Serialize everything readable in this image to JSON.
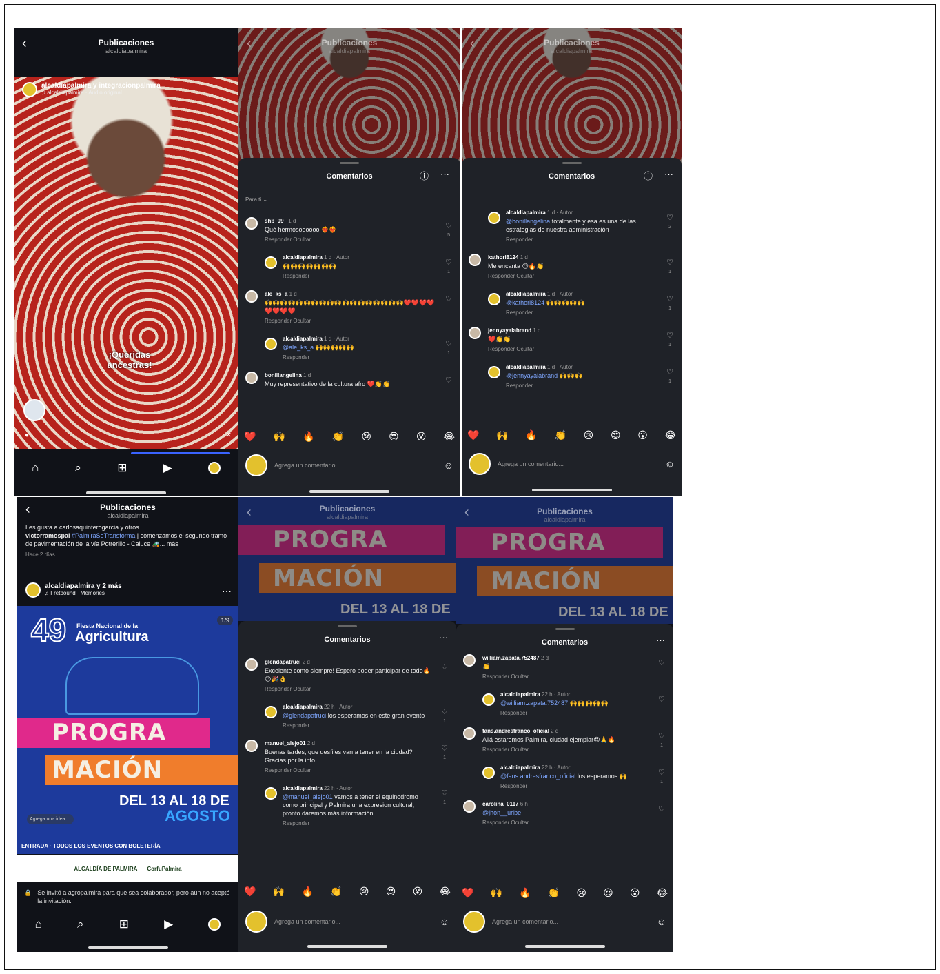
{
  "header": {
    "title": "Publicaciones",
    "subtitle": "alcaldiapalmira"
  },
  "reel": {
    "users": "alcaldiapalmira y integracionpalmira",
    "audio": "♫ alcaldiapalmira · Audio original",
    "overlay_text": "¡Queridas ancestras!"
  },
  "nav": {
    "home": "⌂",
    "search": "⌕",
    "create": "⊞",
    "reels": "▶",
    "profile": ""
  },
  "sheet": {
    "title": "Comentarios",
    "sort": "Para ti ⌄",
    "info_icon": "ⓘ",
    "more": "···"
  },
  "emojis": [
    "❤️",
    "🙌",
    "🔥",
    "👏",
    "😢",
    "😍",
    "😮",
    "😂"
  ],
  "comment_input": {
    "placeholder": "Agrega un comentario...",
    "sticker_icon": "☺"
  },
  "panel2_comments": [
    {
      "user": "shb_09_",
      "meta": "1 d",
      "text": "Qué hermosoooooo ❤️‍🔥❤️‍🔥",
      "actions": "Responder   Ocultar",
      "likes": "5",
      "reply": false
    },
    {
      "user": "alcaldiapalmira",
      "meta": "1 d · Autor",
      "text": "🙌🙌🙌🙌🙌🙌🙌",
      "actions": "Responder",
      "likes": "1",
      "reply": true
    },
    {
      "user": "ale_ks_a",
      "meta": "1 d",
      "text": "🙌🙌🙌🙌🙌🙌🙌🙌🙌🙌🙌🙌🙌🙌🙌🙌🙌🙌❤️❤️❤️❤️❤️❤️❤️❤️",
      "actions": "Responder   Ocultar",
      "likes": "",
      "reply": false
    },
    {
      "user": "alcaldiapalmira",
      "meta": "1 d · Autor",
      "mention": "@ale_ks_a",
      "text": " 🙌🙌🙌🙌🙌",
      "actions": "Responder",
      "likes": "1",
      "reply": true
    },
    {
      "user": "bonillangelina",
      "meta": "1 d",
      "text": "Muy representativo de la cultura afro ❤️👏👏",
      "actions": "",
      "likes": "",
      "reply": false
    }
  ],
  "panel3_comments": [
    {
      "user": "alcaldiapalmira",
      "meta": "1 d · Autor",
      "mention": "@bonillangelina",
      "text": " totalmente y esa es una de las estrategias de nuestra administración",
      "actions": "Responder",
      "likes": "2",
      "reply": true
    },
    {
      "user": "kathori8124",
      "meta": "1 d",
      "text": "Me encanta 😍🔥👏",
      "actions": "Responder   Ocultar",
      "likes": "1",
      "reply": false
    },
    {
      "user": "alcaldiapalmira",
      "meta": "1 d · Autor",
      "mention": "@kathori8124",
      "text": " 🙌🙌🙌🙌🙌",
      "actions": "Responder",
      "likes": "1",
      "reply": true
    },
    {
      "user": "jennyayalabrand",
      "meta": "1 d",
      "text": "❤️👏👏",
      "actions": "Responder   Ocultar",
      "likes": "1",
      "reply": false
    },
    {
      "user": "alcaldiapalmira",
      "meta": "1 d · Autor",
      "mention": "@jennyayalabrand",
      "text": " 🙌🙌🙌",
      "actions": "Responder",
      "likes": "1",
      "reply": true
    }
  ],
  "post": {
    "likes_line": "Les gusta a carlosaquinterogarcia y otros",
    "caption_user": "victorramospal",
    "caption_tag": "#PalmiraSeTransforma",
    "caption_text": " | comenzamos el segundo tramo de pavimentación de la vía Potrerillo - Caluce 🚜... más",
    "time": "Hace 2 días",
    "users": "alcaldiapalmira y 2 más",
    "audio": "♫ Fretbound · Memories",
    "counter": "1/9",
    "fiesta_number": "49",
    "fiesta_small": "Fiesta Nacional de la",
    "fiesta_big": "Agricultura",
    "progra": "PROGRA",
    "macion": "MACIÓN",
    "dates": "DEL 13 AL 18 DE",
    "agosto": "AGOSTO",
    "entry_line": "ENTRADA · TODOS LOS EVENTOS CON BOLETERÍA",
    "idea": "Agrega una idea...",
    "partner1": "ALCALDÍA DE PALMIRA",
    "partner2": "CorfuPalmira",
    "notice": "Se invitó a agropalmira para que sea colaborador, pero aún no aceptó la invitación."
  },
  "panel5_comments": [
    {
      "user": "glendapatruci",
      "meta": "2 d",
      "text": "Excelente como siempre! Espero poder participar de todo🔥😍🎉👌",
      "actions": "Responder   Ocultar",
      "likes": "",
      "reply": false
    },
    {
      "user": "alcaldiapalmira",
      "meta": "22 h · Autor",
      "mention": "@glendapatruci",
      "text": " los esperamos en este gran evento",
      "actions": "Responder",
      "likes": "1",
      "reply": true
    },
    {
      "user": "manuel_alejo01",
      "meta": "2 d",
      "text": "Buenas tardes, que desfiles van a tener en la ciudad? Gracias por la info",
      "actions": "Responder   Ocultar",
      "likes": "1",
      "reply": false
    },
    {
      "user": "alcaldiapalmira",
      "meta": "22 h · Autor",
      "mention": "@manuel_alejo01",
      "text": " vamos a tener el equinodromo como principal y Palmira una expresion cultural, pronto daremos más información",
      "actions": "Responder",
      "likes": "1",
      "reply": true
    }
  ],
  "panel6_comments": [
    {
      "user": "william.zapata.752487",
      "meta": "2 d",
      "text": "👏",
      "actions": "Responder   Ocultar",
      "likes": "",
      "reply": false
    },
    {
      "user": "alcaldiapalmira",
      "meta": "22 h · Autor",
      "mention": "@william.zapata.752487",
      "text": " 🙌🙌🙌🙌🙌",
      "actions": "Responder",
      "likes": "",
      "reply": true
    },
    {
      "user": "fans.andresfranco_oficial",
      "meta": "2 d",
      "text": "Allá estaremos Palmira, ciudad ejemplar😍🙏🔥",
      "actions": "Responder   Ocultar",
      "likes": "1",
      "reply": false
    },
    {
      "user": "alcaldiapalmira",
      "meta": "22 h · Autor",
      "mention": "@fans.andresfranco_oficial",
      "text": " los esperamos 🙌",
      "actions": "Responder",
      "likes": "1",
      "reply": true
    },
    {
      "user": "carolina_0117",
      "meta": "6 h",
      "mention": "@jhon__uribe",
      "text": "",
      "actions": "Responder   Ocultar",
      "likes": "",
      "reply": false
    }
  ],
  "colors": {
    "bg": "#101218",
    "sheet": "#1f2228",
    "mention": "#7fa7ff",
    "accent_yellow": "#e3c12d",
    "pink": "#e0298b",
    "orange": "#f07d2c"
  }
}
